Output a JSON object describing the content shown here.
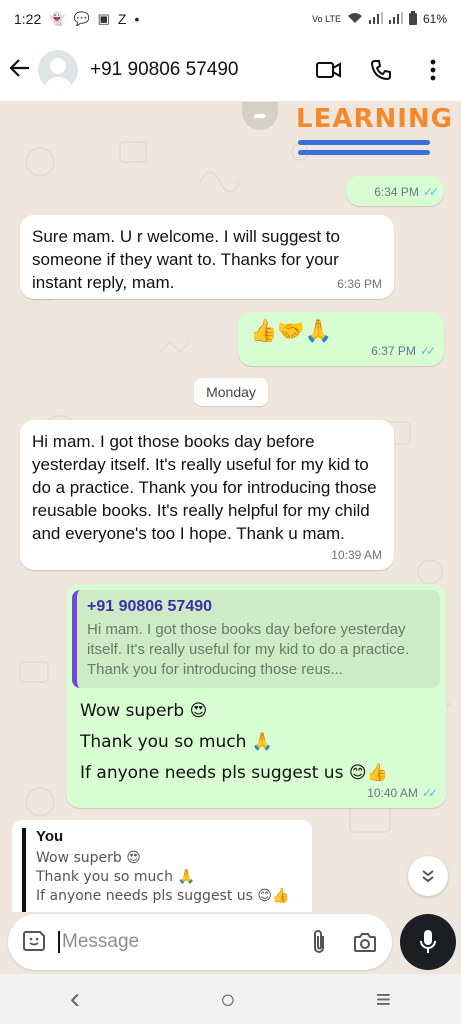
{
  "status": {
    "time": "1:22",
    "letter": "Z",
    "dot": "•",
    "network": "Vo LTE",
    "battery": "61%"
  },
  "header": {
    "contact": "+91 90806 57490"
  },
  "learning_card": {
    "word": "LEARNING",
    "time": "6:34 PM"
  },
  "messages": [
    {
      "id": "m1",
      "text": "Sure mam. U r welcome. I will suggest to someone if they want to. Thanks for your instant reply, mam.",
      "time": "6:36 PM"
    },
    {
      "id": "m2",
      "text": "👍🤝🙏",
      "time": "6:37 PM"
    },
    {
      "id": "day",
      "text": "Monday"
    },
    {
      "id": "m3",
      "text": "Hi mam. I got those books day before yesterday itself. It's really useful for my kid to do a practice. Thank you for introducing those reusable books. It's really helpful for my child and everyone's too I hope. Thank u mam.",
      "time": "10:39 AM"
    },
    {
      "id": "m4",
      "quote_name": "+91 90806 57490",
      "quote_text": "Hi mam. I got those books day before yesterday itself. It's really useful for my kid to do a practice. Thank you for introducing those reus...",
      "line1": "Wow superb 😍",
      "line2": "Thank you so much 🙏",
      "line3": "If anyone needs pls suggest us 😊👍",
      "time": "10:40 AM"
    }
  ],
  "reply_preview": {
    "name": "You",
    "line1": "Wow superb 😍",
    "line2": "Thank you so much 🙏",
    "line3": "If anyone needs pls suggest us 😊👍"
  },
  "composer": {
    "placeholder": "Message"
  },
  "navbar": {
    "back": "‹",
    "home": "○",
    "recents": "≡"
  }
}
